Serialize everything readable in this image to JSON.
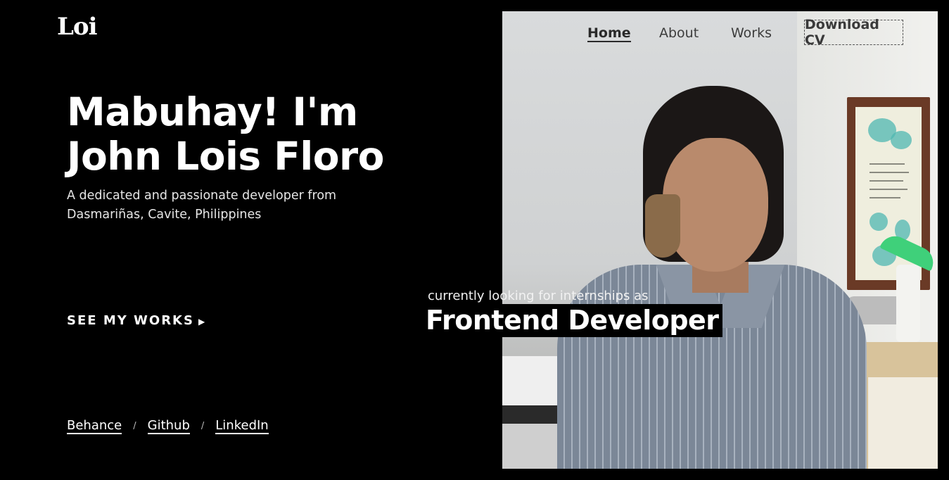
{
  "brand": {
    "logo": "Loi"
  },
  "nav": {
    "items": [
      "Home",
      "About",
      "Works"
    ],
    "active": "Home",
    "download_label": "Download CV"
  },
  "hero": {
    "title": "Mabuhay! I'm John Lois Floro",
    "subtitle": "A dedicated and passionate developer from Dasmariñas, Cavite, Philippines",
    "cta_label": "SEE MY WORKS",
    "cta_icon": "play-arrow-icon"
  },
  "status": {
    "looking": "currently looking for internships as",
    "role": "Frontend Developer"
  },
  "socials": {
    "items": [
      "Behance",
      "Github",
      "LinkedIn"
    ],
    "separator": "/"
  },
  "colors": {
    "background": "#000000",
    "text": "#ffffff",
    "nav_text": "#3c3c3c"
  }
}
